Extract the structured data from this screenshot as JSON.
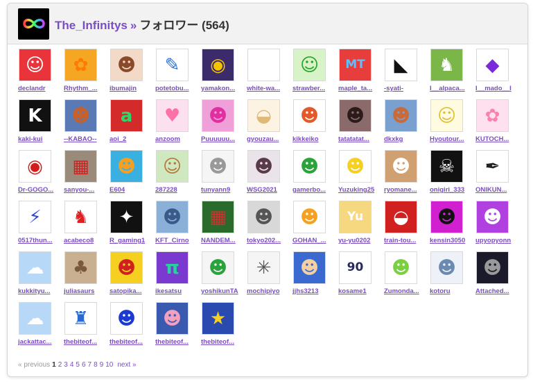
{
  "header": {
    "username": "The_Infinitys",
    "separator": "»",
    "title": "フォロワー (564)"
  },
  "pagination": {
    "previous": "« previous",
    "current": "1",
    "pages": [
      "2",
      "3",
      "4",
      "5",
      "6",
      "7",
      "8",
      "9",
      "10"
    ],
    "next": "next »"
  },
  "users": [
    {
      "name": "declandr",
      "bg": "#e8343a",
      "glyph": "☺",
      "fg": "#ffffff"
    },
    {
      "name": "Rhythm_...",
      "bg": "#f5a623",
      "glyph": "✿",
      "fg": "#ff7a00"
    },
    {
      "name": "ibumajin",
      "bg": "#f3d9c8",
      "glyph": "☻",
      "fg": "#8a4a2a"
    },
    {
      "name": "potetobu...",
      "bg": "#ffffff",
      "glyph": "✎",
      "fg": "#2a6fd1"
    },
    {
      "name": "yamakon...",
      "bg": "#3b2b6b",
      "glyph": "◉",
      "fg": "#f5c400"
    },
    {
      "name": "white-wa...",
      "bg": "#ffffff",
      "glyph": "",
      "fg": "#ffffff"
    },
    {
      "name": "strawber...",
      "bg": "#d9f3c8",
      "glyph": "☺",
      "fg": "#2aa32a"
    },
    {
      "name": "maple_ta...",
      "bg": "#e83d3d",
      "glyph": "MT",
      "fg": "#5bc0ff"
    },
    {
      "name": "-syati-",
      "bg": "#ffffff",
      "glyph": "◣",
      "fg": "#111111"
    },
    {
      "name": "I__alpaca...",
      "bg": "#7ab648",
      "glyph": "♞",
      "fg": "#ffffff"
    },
    {
      "name": "I__mado__I",
      "bg": "#ffffff",
      "glyph": "◆",
      "fg": "#7a2ad9"
    },
    {
      "name": "kaki-kui",
      "bg": "#111111",
      "glyph": "K",
      "fg": "#ffffff"
    },
    {
      "name": "--KABAO--",
      "bg": "#5a7ab5",
      "glyph": "☻",
      "fg": "#c8602a"
    },
    {
      "name": "aoi_2",
      "bg": "#d42a2a",
      "glyph": "a",
      "fg": "#2ad96a"
    },
    {
      "name": "anzoom",
      "bg": "#fbe0ef",
      "glyph": "♥",
      "fg": "#ff6fa8"
    },
    {
      "name": "Puuuuuu...",
      "bg": "#f0a0d8",
      "glyph": "☻",
      "fg": "#e030a0"
    },
    {
      "name": "gyouzau...",
      "bg": "#fdf3e3",
      "glyph": "◒",
      "fg": "#e0b878"
    },
    {
      "name": "kikkeiko",
      "bg": "#ffffff",
      "glyph": "☻",
      "fg": "#e05a2a"
    },
    {
      "name": "tatatatat...",
      "bg": "#8a6a6a",
      "glyph": "☻",
      "fg": "#2b1b1b"
    },
    {
      "name": "dkxkg",
      "bg": "#7aa0d0",
      "glyph": "☻",
      "fg": "#c86a3a"
    },
    {
      "name": "Hyoutour...",
      "bg": "#fffbe0",
      "glyph": "☺",
      "fg": "#e0c030"
    },
    {
      "name": "KUTOCH...",
      "bg": "#ffe0ef",
      "glyph": "✿",
      "fg": "#ff80b0"
    },
    {
      "name": "Dr-GOGO...",
      "bg": "#ffffff",
      "glyph": "◉",
      "fg": "#d41a1a"
    },
    {
      "name": "sanyou-...",
      "bg": "#9a8a7a",
      "glyph": "▦",
      "fg": "#d02020"
    },
    {
      "name": "E604",
      "bg": "#3ab0e0",
      "glyph": "☻",
      "fg": "#f5a020"
    },
    {
      "name": "287228",
      "bg": "#d0e8c0",
      "glyph": "☺",
      "fg": "#b07a3a"
    },
    {
      "name": "tunyann9",
      "bg": "#f5f5f5",
      "glyph": "☻",
      "fg": "#999999"
    },
    {
      "name": "WSG2021",
      "bg": "#ebe3ea",
      "glyph": "☻",
      "fg": "#5a3a4a"
    },
    {
      "name": "gamerbo...",
      "bg": "#ffffff",
      "glyph": "☻",
      "fg": "#2aa33a"
    },
    {
      "name": "Yuzuking25",
      "bg": "#ffffff",
      "glyph": "☻",
      "fg": "#f5d020"
    },
    {
      "name": "ryomane...",
      "bg": "#d0a070",
      "glyph": "☻",
      "fg": "#ffffff"
    },
    {
      "name": "onigiri_333",
      "bg": "#111111",
      "glyph": "☠",
      "fg": "#ffffff"
    },
    {
      "name": "ONIKUN...",
      "bg": "#ffffff",
      "glyph": "✒",
      "fg": "#222222"
    },
    {
      "name": "0517thun...",
      "bg": "#ffffff",
      "glyph": "⚡",
      "fg": "#2a4ad0"
    },
    {
      "name": "acabeco8",
      "bg": "#ffffff",
      "glyph": "♞",
      "fg": "#e02020"
    },
    {
      "name": "R_gaming1",
      "bg": "#111111",
      "glyph": "✦",
      "fg": "#ffffff"
    },
    {
      "name": "KFT_Cirno",
      "bg": "#8ab0d8",
      "glyph": "☻",
      "fg": "#3a5a8a"
    },
    {
      "name": "NANDEM...",
      "bg": "#2a6a2a",
      "glyph": "▦",
      "fg": "#d03030"
    },
    {
      "name": "tokyo202...",
      "bg": "#d8d8d8",
      "glyph": "☻",
      "fg": "#555555"
    },
    {
      "name": "GOHAN_...",
      "bg": "#ffffff",
      "glyph": "☻",
      "fg": "#f5a020"
    },
    {
      "name": "yu-yu0202",
      "bg": "#f5d880",
      "glyph": "Yu",
      "fg": "#ffffff"
    },
    {
      "name": "train-tou...",
      "bg": "#d02020",
      "glyph": "◒",
      "fg": "#ffffff"
    },
    {
      "name": "kensin3050",
      "bg": "#d020d0",
      "glyph": "☻",
      "fg": "#111111"
    },
    {
      "name": "upyopyonn",
      "bg": "#b040e0",
      "glyph": "☻",
      "fg": "#ffffff"
    },
    {
      "name": "kukkityu...",
      "bg": "#b8d8f8",
      "glyph": "☁",
      "fg": "#ffffff"
    },
    {
      "name": "juliasaurs",
      "bg": "#c8b090",
      "glyph": "♣",
      "fg": "#7a5a3a"
    },
    {
      "name": "satopika...",
      "bg": "#f5d020",
      "glyph": "☻",
      "fg": "#d02020"
    },
    {
      "name": "ikesatsu",
      "bg": "#7a3ad0",
      "glyph": "π",
      "fg": "#2ad0a0"
    },
    {
      "name": "yoshikunTA",
      "bg": "#f5f5f5",
      "glyph": "☻",
      "fg": "#2aa33a"
    },
    {
      "name": "mochipiyo",
      "bg": "#f5f5f5",
      "glyph": "✳",
      "fg": "#555555"
    },
    {
      "name": "jjhs3213",
      "bg": "#3a6ad0",
      "glyph": "☻",
      "fg": "#f5d0a0"
    },
    {
      "name": "kosame1",
      "bg": "#ffffff",
      "glyph": "90",
      "fg": "#2a2a5a"
    },
    {
      "name": "Zumonda...",
      "bg": "#ffffff",
      "glyph": "☻",
      "fg": "#7ad040"
    },
    {
      "name": "kotoru",
      "bg": "#eef2f8",
      "glyph": "☻",
      "fg": "#6a8ab0"
    },
    {
      "name": "Attached...",
      "bg": "#1a1a2a",
      "glyph": "☻",
      "fg": "#999999"
    },
    {
      "name": "jackattac...",
      "bg": "#b8d8f8",
      "glyph": "☁",
      "fg": "#ffffff"
    },
    {
      "name": "thebiteof...",
      "bg": "#ffffff",
      "glyph": "♜",
      "fg": "#2a6ad0"
    },
    {
      "name": "thebiteof...",
      "bg": "#ffffff",
      "glyph": "☻",
      "fg": "#1a3ad0"
    },
    {
      "name": "thebiteof...",
      "bg": "#3a5ab0",
      "glyph": "☻",
      "fg": "#f0a0c0"
    },
    {
      "name": "thebiteof...",
      "bg": "#2a4ab0",
      "glyph": "★",
      "fg": "#f5d020"
    }
  ]
}
